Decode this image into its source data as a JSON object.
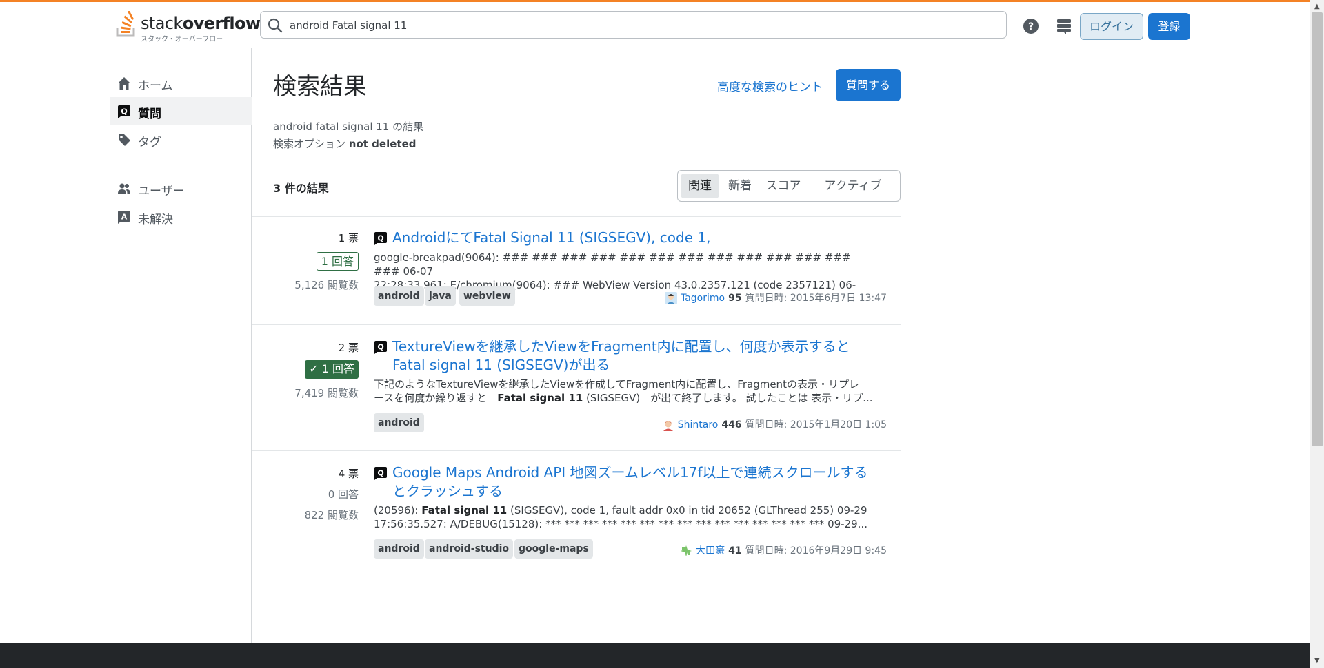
{
  "header": {
    "logo_word_1": "stack",
    "logo_word_2": "overflow",
    "logo_sub": "スタック・オーバーフロー",
    "search_value": "android Fatal signal 11",
    "login_label": "ログイン",
    "signup_label": "登録",
    "help_icon": "help-icon",
    "inbox_icon": "stack-exchange-icon",
    "accent": "#f48225"
  },
  "sidebar": {
    "items": [
      {
        "label": "ホーム",
        "icon": "home-icon"
      },
      {
        "label": "質問",
        "icon": "questions-icon",
        "active": true
      },
      {
        "label": "タグ",
        "icon": "tag-icon"
      },
      {
        "label": "ユーザー",
        "icon": "users-icon"
      },
      {
        "label": "未解決",
        "icon": "unanswered-icon"
      }
    ]
  },
  "main": {
    "title": "検索結果",
    "advanced_link": "高度な検索のヒント",
    "ask_button": "質問する",
    "results_for": "android fatal signal 11 の結果",
    "search_options_label": "検索オプション",
    "search_options_value": "not deleted",
    "result_count": "3 件の結果",
    "filters": [
      "関連",
      "新着",
      "スコア",
      "アクティブ"
    ],
    "selected_filter": "関連"
  },
  "results": [
    {
      "votes": "1 票",
      "answers": "1 回答",
      "answer_state": "answered",
      "views": "5,126 閲覧数",
      "title": "AndroidにてFatal Signal 11 (SIGSEGV), code 1,",
      "excerpt_line1": "google-breakpad(9064): ### ### ### ### ### ### ### ### ### ### ### ### ### 06-07",
      "excerpt_line2": "22:28:33.961: E/chromium(9064): ### WebView Version 43.0.2357.121 (code 2357121) 06-07...",
      "tags": [
        "android",
        "java",
        "webview"
      ],
      "user": "Tagorimo",
      "rep": "95",
      "asked": "質問日時: 2015年6月7日 13:47"
    },
    {
      "votes": "2 票",
      "answers": "1 回答",
      "answer_state": "accepted",
      "views": "7,419 閲覧数",
      "title": "TextureViewを継承したViewをFragment内に配置し、何度か表示すると Fatal signal 11 (SIGSEGV)が出る",
      "excerpt_line1": "下記のようなTextureViewを継承したViewを作成してFragment内に配置し、Fragmentの表示・リプレ",
      "excerpt_line2_a": "ースを何度か繰り返すと　",
      "excerpt_line2_b": "Fatal signal 11",
      "excerpt_line2_c": " (SIGSEGV)　が出て終了します。 試したことは 表示・リプ...",
      "tags": [
        "android"
      ],
      "user": "Shintaro",
      "rep": "446",
      "asked": "質問日時: 2015年1月20日 1:05"
    },
    {
      "votes": "4 票",
      "answers": "0 回答",
      "answer_state": "none",
      "views": "822 閲覧数",
      "title": "Google Maps Android API 地図ズームレベル17f以上で連続スクロールするとクラッシュする",
      "excerpt_line1_a": "(20596): ",
      "excerpt_line1_b": "Fatal signal 11",
      "excerpt_line1_c": " (SIGSEGV), code 1, fault addr 0x0 in tid 20652 (GLThread 255) 09-29",
      "excerpt_line2": "17:56:35.527: A/DEBUG(15128): *** *** *** *** *** *** *** *** *** *** *** *** *** *** *** 09-29...",
      "tags": [
        "android",
        "android-studio",
        "google-maps"
      ],
      "user": "大田豪",
      "rep": "41",
      "asked": "質問日時: 2016年9月29日 9:45"
    }
  ],
  "colors": {
    "link": "#1b75d0",
    "answered": "#2f6f44",
    "footer": "#232629"
  }
}
